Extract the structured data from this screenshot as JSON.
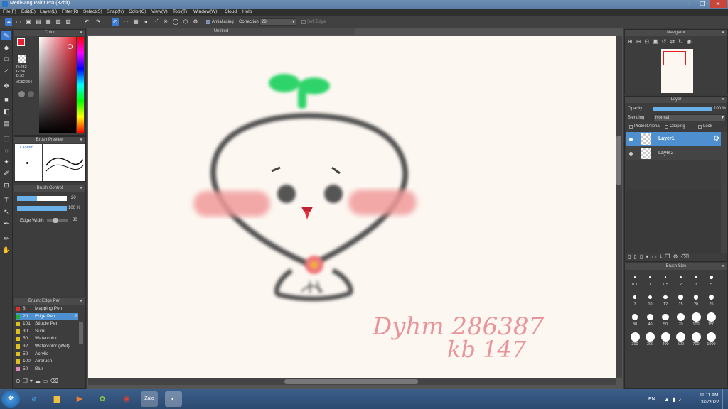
{
  "window": {
    "title": "MediBang Paint Pro (32bit)"
  },
  "menu": [
    "File(F)",
    "Edit(E)",
    "Layer(L)",
    "Filter(R)",
    "Select(S)",
    "Snap(N)",
    "Color(C)",
    "View(V)",
    "Tool(T)",
    "Window(W)",
    "Cloud",
    "Help"
  ],
  "toolbar": {
    "antialias_label": "Antialiasing",
    "correction_label": "Correction",
    "correction_value": "28",
    "softedge_label": "Soft Edge"
  },
  "color_panel": {
    "title": "Color",
    "r": "R:232",
    "g": "G:34",
    "b": "B:52",
    "hex": "#E82234",
    "primary": "#e82234"
  },
  "brush_preview": {
    "title": "Brush Preview",
    "size": "1.45mm"
  },
  "brush_control": {
    "title": "Brush Control",
    "size_value": "20",
    "opacity_value": "100 %",
    "edge_label": "Edge Width",
    "edge_value": "30"
  },
  "brush_list": {
    "title": "Brush: Edge Pen",
    "items": [
      {
        "size": "8",
        "name": "Mapping Pen",
        "color": "#d83030"
      },
      {
        "size": "20",
        "name": "Edge Pen",
        "color": "#20b030",
        "selected": true
      },
      {
        "size": "101",
        "name": "Stipple Pen",
        "color": "#d8c020"
      },
      {
        "size": "30",
        "name": "Sumi",
        "color": "#e0c020"
      },
      {
        "size": "50",
        "name": "Watercolor",
        "color": "#e0c020"
      },
      {
        "size": "32",
        "name": "Watercolor (Wet)",
        "color": "#e0c020"
      },
      {
        "size": "50",
        "name": "Acrylic",
        "color": "#e0c020"
      },
      {
        "size": "100",
        "name": "Airbrush",
        "color": "#e0c020"
      },
      {
        "size": "50",
        "name": "Blur",
        "color": "#e08ac0"
      }
    ]
  },
  "canvas": {
    "tab": "Untitled",
    "text_line1": "Dyhm 286387",
    "text_line2": "kb 147"
  },
  "navigator": {
    "title": "Navigator"
  },
  "layer_panel": {
    "title": "Layer",
    "opacity_label": "Opacity",
    "opacity_value": "100 %",
    "blending_label": "Blending",
    "blending_value": "Normal",
    "protect_alpha": "Protect Alpha",
    "clipping": "Clipping",
    "lock": "Lock",
    "layers": [
      {
        "name": "Layer1",
        "selected": true
      },
      {
        "name": "Layer2",
        "selected": false
      }
    ]
  },
  "brush_size": {
    "title": "Brush Size",
    "sizes": [
      "0.7",
      "1",
      "1.5",
      "2",
      "3",
      "5",
      "7",
      "10",
      "12",
      "15",
      "20",
      "25",
      "30",
      "40",
      "50",
      "70",
      "100",
      "150",
      "200",
      "300",
      "400",
      "500",
      "700",
      "1000"
    ]
  },
  "taskbar": {
    "lang": "EN",
    "time": "11:11 AM",
    "date": "3/2/2022"
  }
}
